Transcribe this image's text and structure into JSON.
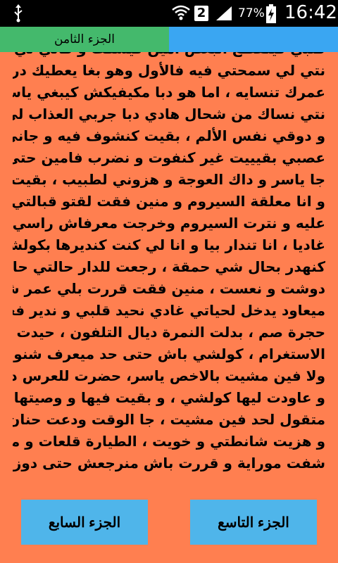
{
  "status_bar": {
    "usb_icon": "usb-icon",
    "wifi_icon": "wifi-icon",
    "sim_slot": "2",
    "signal_icon": "signal-icon",
    "battery_percent": "77%",
    "battery_icon": "charging-battery-icon",
    "time": "16:42"
  },
  "tabs": [
    {
      "label": "الجزء الثامن",
      "active": true,
      "color": "#44B96C"
    },
    {
      "label": "",
      "active": false,
      "color": "#3AA6F2"
    }
  ],
  "story_lines": [
    "فلبي كيتقطع البعض امين كيسكت و قالي لي السباب",
    "نتي لي سمحتي فيه فالأول وهو بغا يعطيك درس باش",
    "عمرك تنسايه ، اما هو دبا مكيفيكش كيبغي ياسمين و",
    "نتي نساك من شحال هادي دبا جربي العذاب لي عذبتيه",
    "و دوقي نفس الألم ، بقيت كنشوف فيه و جاني انهيار",
    "عصبي بقيييت غير كنفوت و نضرب فامين حتى سخفت ،",
    "جا ياسر و داك العوجة و هزوني لطبيب ، بقيت ساعتاين",
    "و انا معلقة السيروم و منين فقت لقتو قبالتي ، جريت",
    "عليه و نترت السيروم وخرجت معرفاش راسي فين",
    "غاديا ، انا تندار بيا و انا لي كنت كنديرها بكولشي و",
    "كنهدر بحال شي حمقة ، رجعت للدار حالتي حالة ،",
    "دوشت و نعست ، منين فقت قررت بلي عمر شي حد",
    "ميعاود يدخل لحياتي غادي نحيد قلبي و ندير فعاوطو",
    "حجرة صم ، بدلت النمرة ديال التلفون ، حيدت الفايسبوك",
    "الاستغرام ، كولشي باش حتى حد ميعرف شنو وقعلي",
    "ولا فين مشيت بالاخص ياسر، حضرت للعرس ديال حنان",
    "و عاودت ليها كولشي ، و بقيت فيها و وصيتها باش",
    "متقول لحد فين مشيت ، جا الوقت ودعت حنان و عائلتي",
    "و هزيت شانطتي و خويت ، الطيارة قلعات و مبقاتش",
    "شفت موراية و قررت باش منرجعش حتى دوز عامين"
  ],
  "buttons": {
    "previous_label": "الجزء السابع",
    "next_label": "الجزء التاسع"
  },
  "colors": {
    "background": "#FF7F50",
    "button": "#4FB5EA"
  }
}
